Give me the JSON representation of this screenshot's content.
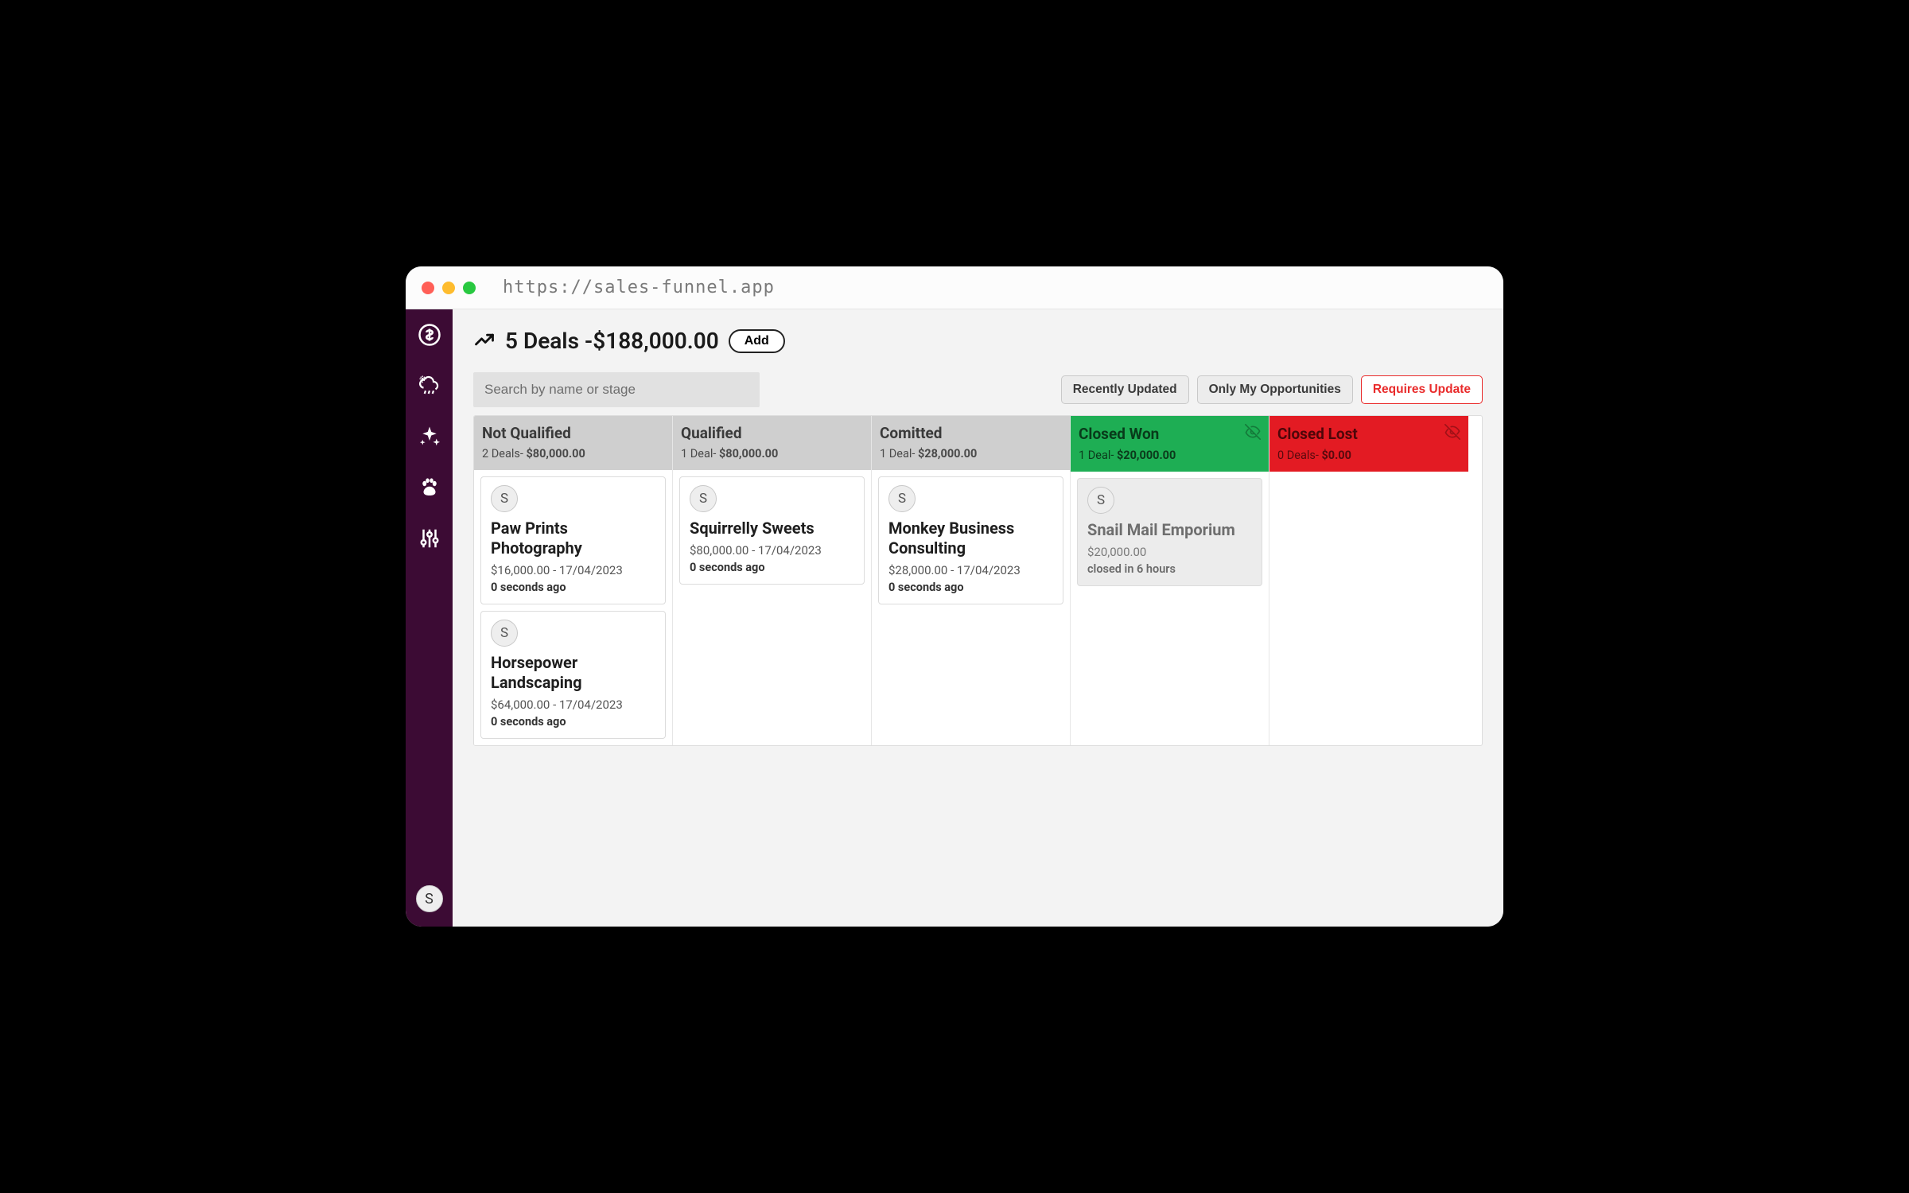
{
  "browser": {
    "url": "https://sales-funnel.app"
  },
  "sidebar": {
    "user_initial": "S",
    "items": [
      {
        "name": "dollar-icon"
      },
      {
        "name": "weather-icon"
      },
      {
        "name": "sparkle-icon"
      },
      {
        "name": "paw-icon"
      },
      {
        "name": "tuning-icon"
      }
    ]
  },
  "header": {
    "title": "5 Deals -$188,000.00",
    "add_label": "Add"
  },
  "search": {
    "placeholder": "Search by name or stage"
  },
  "filters": {
    "recent": "Recently Updated",
    "mine": "Only My Opportunities",
    "needs": "Requires Update"
  },
  "columns": [
    {
      "title": "Not Qualified",
      "count_label": "2 Deals- ",
      "amount": "$80,000.00",
      "variant": "default",
      "eye": false,
      "cards": [
        {
          "avatar": "S",
          "title": "Paw Prints Photography",
          "meta": "$16,000.00 - 17/04/2023",
          "age": "0 seconds ago",
          "muted": false
        },
        {
          "avatar": "S",
          "title": "Horsepower Landscaping",
          "meta": "$64,000.00 - 17/04/2023",
          "age": "0 seconds ago",
          "muted": false
        }
      ]
    },
    {
      "title": "Qualified",
      "count_label": "1 Deal- ",
      "amount": "$80,000.00",
      "variant": "default",
      "eye": false,
      "cards": [
        {
          "avatar": "S",
          "title": "Squirrelly Sweets",
          "meta": "$80,000.00 - 17/04/2023",
          "age": "0 seconds ago",
          "muted": false
        }
      ]
    },
    {
      "title": "Comitted",
      "count_label": "1 Deal- ",
      "amount": "$28,000.00",
      "variant": "default",
      "eye": false,
      "cards": [
        {
          "avatar": "S",
          "title": "Monkey Business Consulting",
          "meta": "$28,000.00 - 17/04/2023",
          "age": "0 seconds ago",
          "muted": false
        }
      ]
    },
    {
      "title": "Closed Won",
      "count_label": "1 Deal- ",
      "amount": "$20,000.00",
      "variant": "won",
      "eye": true,
      "cards": [
        {
          "avatar": "S",
          "title": "Snail Mail Emporium",
          "meta": "$20,000.00",
          "age": "closed in 6 hours",
          "muted": true
        }
      ]
    },
    {
      "title": "Closed Lost",
      "count_label": "0 Deals- ",
      "amount": "$0.00",
      "variant": "lost",
      "eye": true,
      "cards": []
    }
  ]
}
